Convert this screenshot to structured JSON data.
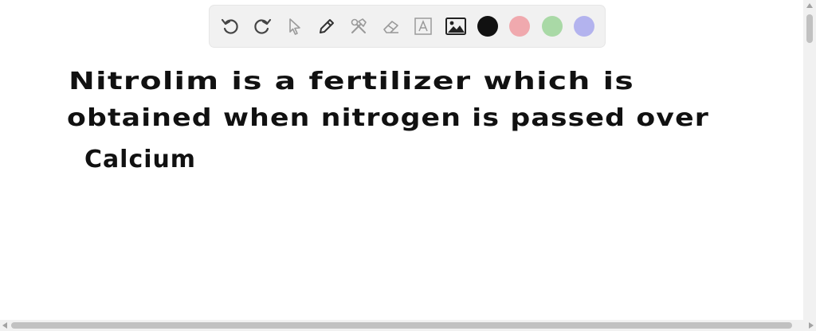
{
  "toolbar": {
    "tools": [
      {
        "icon": "undo-icon"
      },
      {
        "icon": "redo-icon"
      },
      {
        "icon": "pointer-icon"
      },
      {
        "icon": "pencil-icon"
      },
      {
        "icon": "tools-icon"
      },
      {
        "icon": "eraser-icon"
      },
      {
        "icon": "text-box-icon"
      },
      {
        "icon": "image-icon"
      }
    ],
    "colors": {
      "black": "#111111",
      "red": "#f0a9ae",
      "green": "#a9d9a6",
      "blue": "#b3b3ee"
    }
  },
  "canvas": {
    "lines": [
      {
        "text": "Nitrolim is a fertilizer which is"
      },
      {
        "text": "obtained when nitrogen is passed over"
      },
      {
        "text": "Calcium"
      }
    ]
  }
}
